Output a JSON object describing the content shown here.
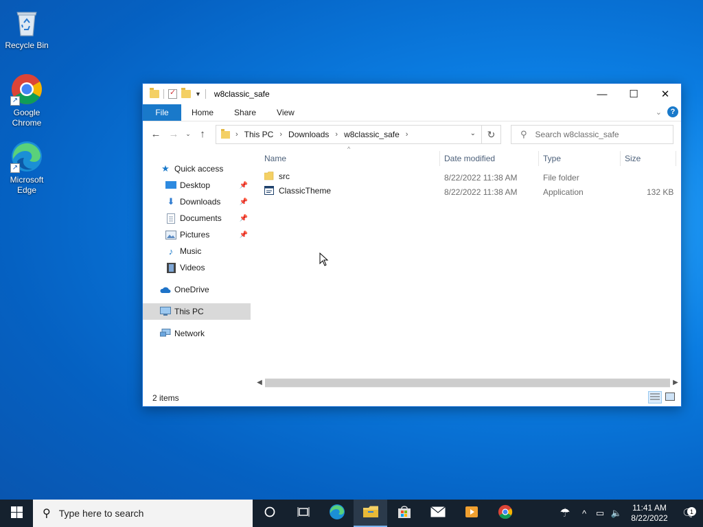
{
  "desktop": {
    "icons": [
      {
        "label": "Recycle Bin",
        "icon": "recycle-bin-icon"
      },
      {
        "label": "Google Chrome",
        "icon": "chrome-icon"
      },
      {
        "label": "Microsoft Edge",
        "icon": "edge-icon"
      }
    ]
  },
  "explorer": {
    "title": "w8classic_safe",
    "window_controls": {
      "minimize": "—",
      "maximize": "☐",
      "close": "✕"
    },
    "ribbon": {
      "file": "File",
      "tabs": [
        "Home",
        "Share",
        "View"
      ],
      "help": "?"
    },
    "address": {
      "crumbs": [
        "This PC",
        "Downloads",
        "w8classic_safe"
      ]
    },
    "search": {
      "placeholder": "Search w8classic_safe"
    },
    "nav": {
      "quick_access": "Quick access",
      "quick_items": [
        {
          "label": "Desktop",
          "icon": "desktop-icon",
          "pinned": true
        },
        {
          "label": "Downloads",
          "icon": "downloads-icon",
          "pinned": true
        },
        {
          "label": "Documents",
          "icon": "documents-icon",
          "pinned": true
        },
        {
          "label": "Pictures",
          "icon": "pictures-icon",
          "pinned": true
        },
        {
          "label": "Music",
          "icon": "music-icon",
          "pinned": false
        },
        {
          "label": "Videos",
          "icon": "videos-icon",
          "pinned": false
        }
      ],
      "onedrive": "OneDrive",
      "this_pc": "This PC",
      "network": "Network"
    },
    "columns": {
      "name": "Name",
      "date": "Date modified",
      "type": "Type",
      "size": "Size"
    },
    "files": [
      {
        "name": "src",
        "date": "8/22/2022 11:38 AM",
        "type": "File folder",
        "size": "",
        "icon": "folder-icon"
      },
      {
        "name": "ClassicTheme",
        "date": "8/22/2022 11:38 AM",
        "type": "Application",
        "size": "132 KB",
        "icon": "application-icon"
      }
    ],
    "status": "2 items"
  },
  "taskbar": {
    "search_placeholder": "Type here to search",
    "time": "11:41 AM",
    "date": "8/22/2022",
    "notification_count": "1"
  },
  "colors": {
    "accent": "#1979ca",
    "taskbar": "#15212e",
    "folder": "#f4d064"
  }
}
